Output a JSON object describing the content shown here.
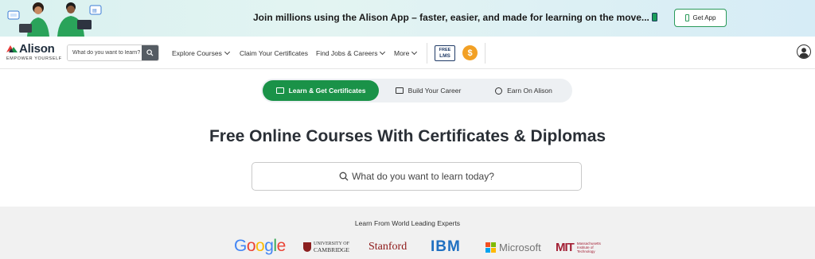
{
  "banner": {
    "text": "Join millions using the Alison App – faster, easier, and made for learning on the move...",
    "button_label": "Get App"
  },
  "nav": {
    "logo_word": "Alison",
    "logo_tagline": "EMPOWER YOURSELF",
    "search_placeholder": "What do you want to learn?",
    "links": {
      "explore": "Explore Courses",
      "certificates": "Claim Your Certificates",
      "jobs": "Find Jobs & Careers",
      "more": "More"
    },
    "free_lms_line1": "FREE",
    "free_lms_line2": "LMS",
    "coin_symbol": "$"
  },
  "tabs": {
    "learn": "Learn & Get Certificates",
    "career": "Build Your Career",
    "earn": "Earn On Alison"
  },
  "hero": {
    "title": "Free Online Courses With Certificates & Diplomas",
    "search_placeholder": "What do you want to learn today?"
  },
  "partners": {
    "title": "Learn From World Leading Experts",
    "google": "Google",
    "cambridge_line1": "UNIVERSITY OF",
    "cambridge_line2": "CAMBRIDGE",
    "stanford": "Stanford",
    "ibm": "IBM",
    "microsoft": "Microsoft",
    "mit_mark": "MIT",
    "mit_line1": "Massachusetts",
    "mit_line2": "Institute of",
    "mit_line3": "Technology"
  },
  "colors": {
    "brand_green": "#1a9248",
    "coin_orange": "#f2a024",
    "stanford_red": "#8c1515",
    "ibm_blue": "#1f70c1"
  }
}
